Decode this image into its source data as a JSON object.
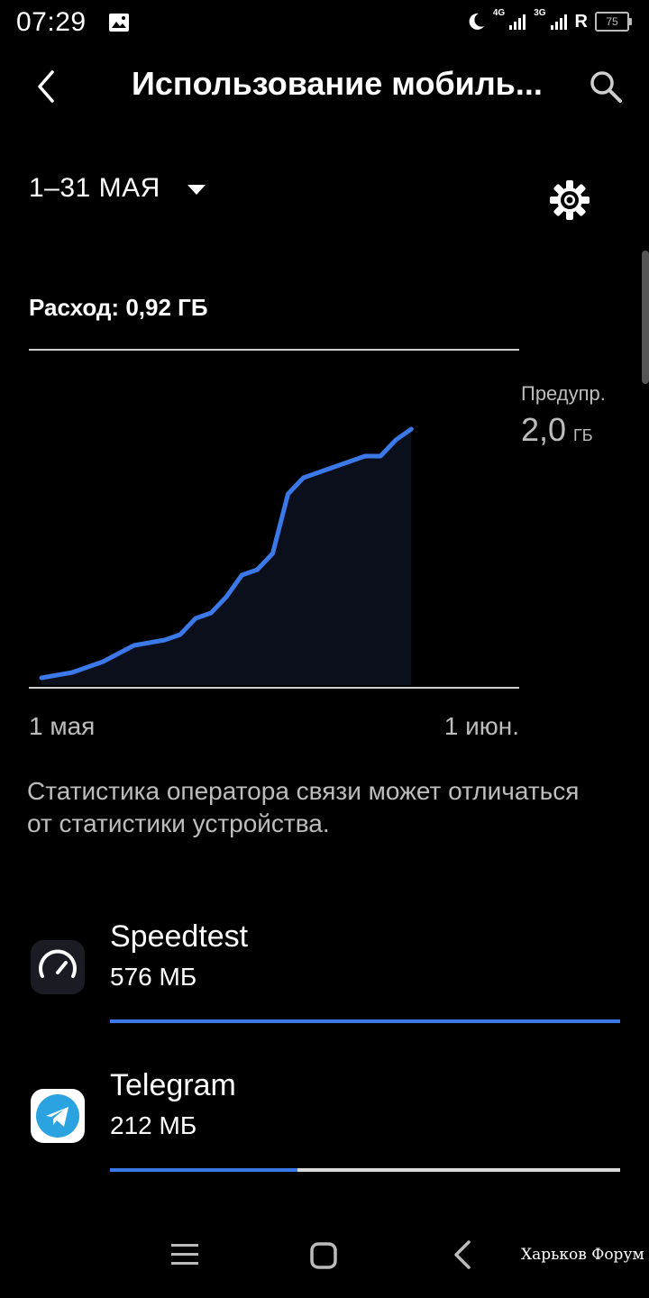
{
  "status_bar": {
    "time": "07:29",
    "signal1_label": "4G",
    "signal2_label": "3G",
    "roaming": "R",
    "battery": "75"
  },
  "header": {
    "title": "Использование мобиль..."
  },
  "period": {
    "label": "1–31 МАЯ"
  },
  "usage": {
    "label": "Расход: 0,92 ГБ"
  },
  "warning": {
    "label": "Предупр.",
    "value": "2,0",
    "unit": "ГБ"
  },
  "chart_data": {
    "type": "area",
    "x_start_label": "1 мая",
    "x_end_label": "1 июн.",
    "series_color": "#3b79e8",
    "x": [
      1,
      3,
      5,
      7,
      9,
      10,
      11,
      12,
      13,
      14,
      15,
      16,
      17,
      18,
      19,
      20,
      21,
      22,
      23,
      24,
      25
    ],
    "cumulative_gb": [
      0.0,
      0.01,
      0.03,
      0.06,
      0.07,
      0.08,
      0.11,
      0.12,
      0.15,
      0.19,
      0.2,
      0.23,
      0.34,
      0.37,
      0.38,
      0.39,
      0.4,
      0.41,
      0.41,
      0.44,
      0.46
    ]
  },
  "note": "Статистика оператора связи может отличаться от статистики устройства.",
  "apps": [
    {
      "name": "Speedtest",
      "size": "576 МБ",
      "fraction": 1.0,
      "icon": "speedtest-icon"
    },
    {
      "name": "Telegram",
      "size": "212 МБ",
      "fraction": 0.368,
      "icon": "telegram-icon"
    }
  ],
  "watermark": "Харьков Форум",
  "colors": {
    "accent": "#3b79e8",
    "background": "#000000"
  }
}
